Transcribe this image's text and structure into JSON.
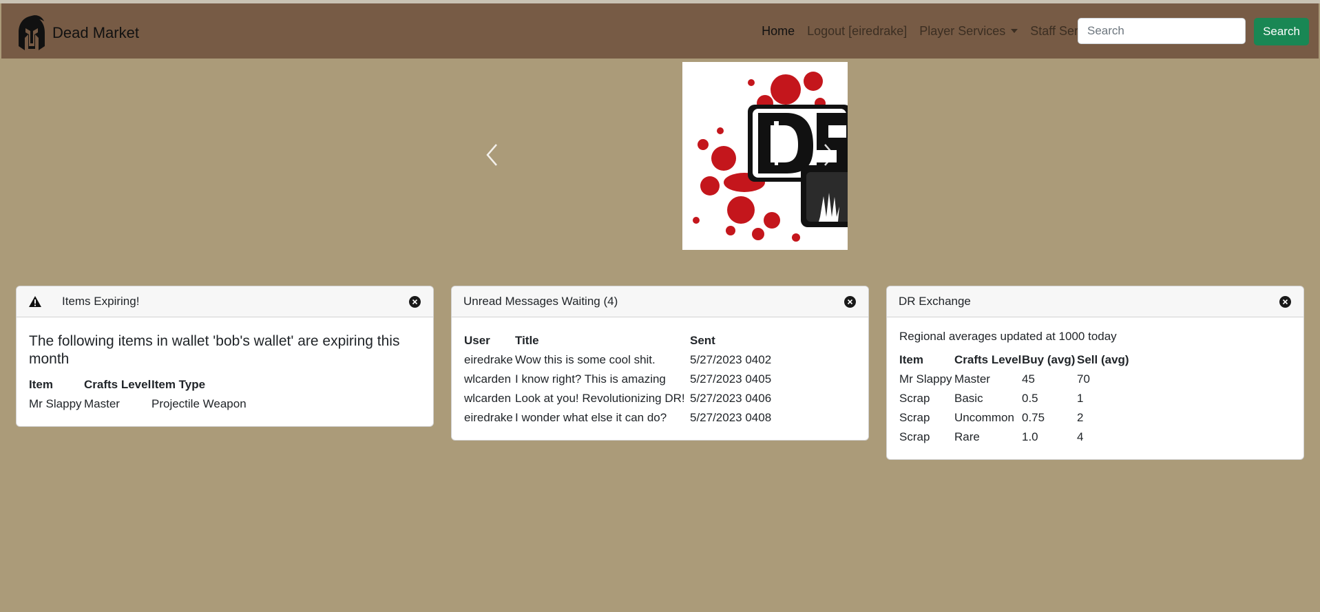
{
  "nav": {
    "brand": "Dead Market",
    "links": [
      {
        "label": "Home"
      },
      {
        "label": "Logout [eiredrake]"
      },
      {
        "label": "Player Services"
      },
      {
        "label": "Staff Services"
      }
    ],
    "search_placeholder": "Search",
    "search_button": "Search"
  },
  "carousel": {
    "image": "dystopia-rising-logo",
    "prev_icon": "chevron-left-icon",
    "next_icon": "chevron-right-icon"
  },
  "expiring": {
    "title": "Items Expiring!",
    "message": "The following items in wallet 'bob's wallet' are expiring this month",
    "headers": [
      "Item",
      "Crafts Level",
      "Item Type"
    ],
    "rows": [
      [
        "Mr Slappy",
        "Master",
        "Projectile Weapon"
      ]
    ]
  },
  "messages": {
    "title": "Unread Messages Waiting (4)",
    "headers": [
      "User",
      "Title",
      "Sent"
    ],
    "rows": [
      [
        "eiredrake",
        "Wow this is some cool shit.",
        "5/27/2023 0402"
      ],
      [
        "wlcarden",
        "I know right? This is amazing",
        "5/27/2023 0405"
      ],
      [
        "wlcarden",
        "Look at you! Revolutionizing DR!",
        "5/27/2023 0406"
      ],
      [
        "eiredrake",
        "I wonder what else it can do?",
        "5/27/2023 0408"
      ]
    ]
  },
  "exchange": {
    "title": "DR Exchange",
    "note": "Regional averages updated at 1000 today",
    "headers": [
      "Item",
      "Crafts Level",
      "Buy (avg)",
      "Sell (avg)"
    ],
    "rows": [
      [
        "Mr Slappy",
        "Master",
        "45",
        "70"
      ],
      [
        "Scrap",
        "Basic",
        "0.5",
        "1"
      ],
      [
        "Scrap",
        "Uncommon",
        "0.75",
        "2"
      ],
      [
        "Scrap",
        "Rare",
        "1.0",
        "4"
      ]
    ]
  },
  "colors": {
    "navbar": "#775b45",
    "page_background": "#ab9b79",
    "search_button": "#198754"
  }
}
